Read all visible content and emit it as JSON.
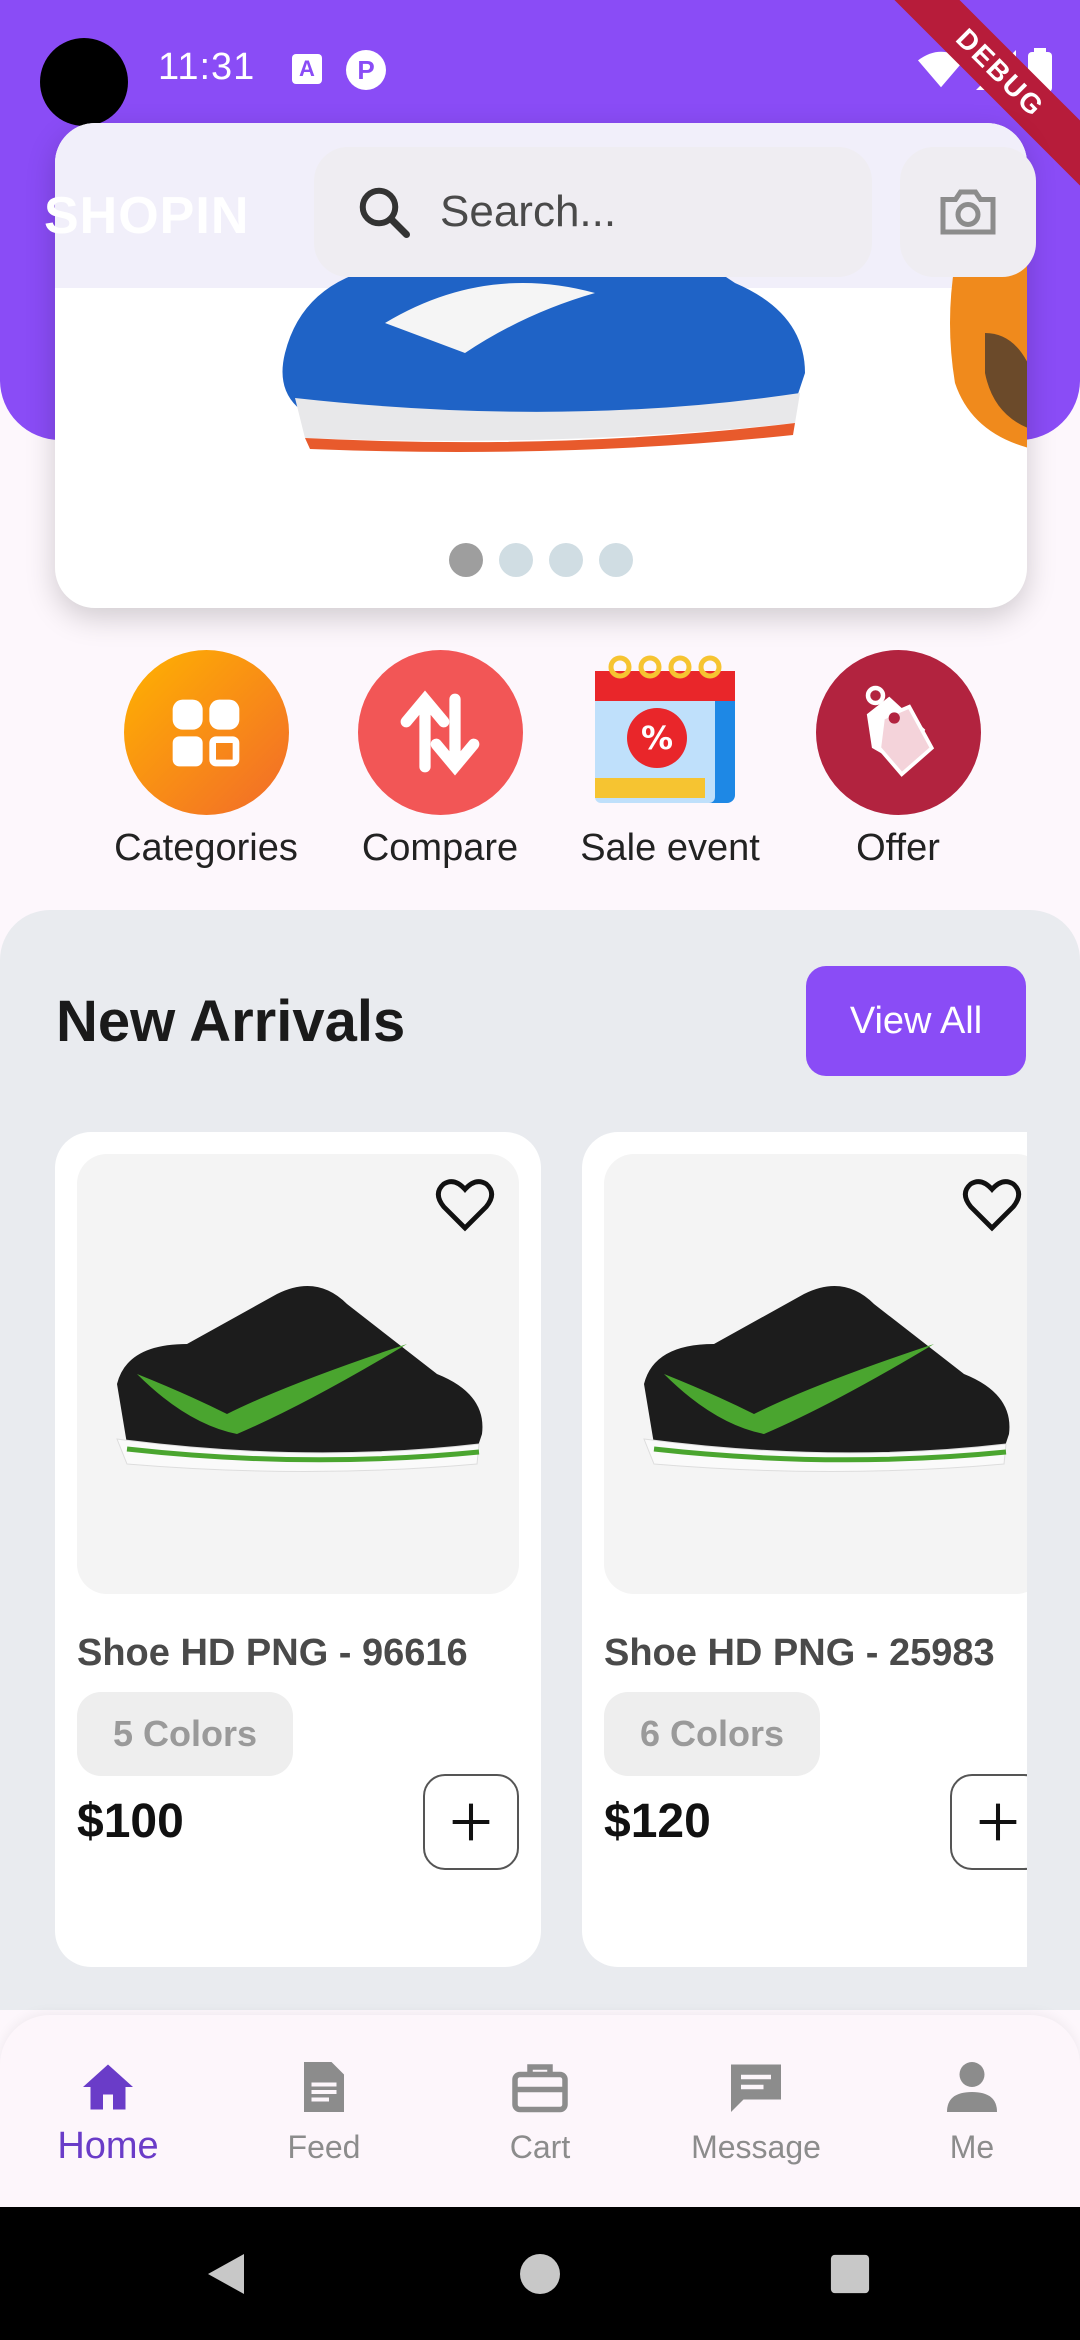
{
  "status_bar": {
    "time": "11:31",
    "debug_label": "DEBUG"
  },
  "header": {
    "brand": "SHOPIN",
    "search": {
      "placeholder": "Search...",
      "value": ""
    }
  },
  "banner": {
    "slides": 4,
    "active_slide": 0
  },
  "quick_actions": [
    {
      "label": "Categories",
      "icon": "categories-icon",
      "color": "#f7931e"
    },
    {
      "label": "Compare",
      "icon": "compare-arrows-icon",
      "color": "#f25656"
    },
    {
      "label": "Sale event",
      "icon": "calendar-sale-icon",
      "color": "#1e88e5"
    },
    {
      "label": "Offer",
      "icon": "price-tag-icon",
      "color": "#b2233f"
    }
  ],
  "new_arrivals": {
    "title": "New Arrivals",
    "view_all_label": "View All",
    "products": [
      {
        "name": "Shoe HD PNG - 96616",
        "colors": "5 Colors",
        "price": "$100"
      },
      {
        "name": "Shoe HD PNG - 25983",
        "colors": "6 Colors",
        "price": "$120"
      }
    ]
  },
  "bottom_nav": [
    {
      "label": "Home",
      "icon": "home-icon",
      "active": true
    },
    {
      "label": "Feed",
      "icon": "feed-icon",
      "active": false
    },
    {
      "label": "Cart",
      "icon": "cart-briefcase-icon",
      "active": false
    },
    {
      "label": "Message",
      "icon": "message-icon",
      "active": false
    },
    {
      "label": "Me",
      "icon": "person-icon",
      "active": false
    }
  ],
  "colors": {
    "accent": "#8a4cf6",
    "active_nav": "#6a3cc8"
  }
}
